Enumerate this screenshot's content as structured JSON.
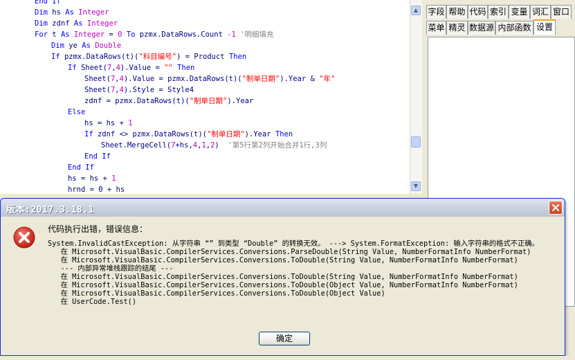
{
  "editor": {
    "lines": [
      {
        "indent": 50,
        "parts": [
          {
            "c": "kw",
            "t": "End If"
          }
        ]
      },
      {
        "indent": 50,
        "parts": [
          {
            "c": "kw",
            "t": "Dim "
          },
          {
            "c": "tx",
            "t": "hs "
          },
          {
            "c": "kw",
            "t": "As "
          },
          {
            "c": "ty",
            "t": "Integer"
          }
        ]
      },
      {
        "indent": 50,
        "parts": [
          {
            "c": "kw",
            "t": "Dim "
          },
          {
            "c": "tx",
            "t": "zdnf "
          },
          {
            "c": "kw",
            "t": "As "
          },
          {
            "c": "ty",
            "t": "Integer"
          }
        ]
      },
      {
        "indent": 50,
        "parts": [
          {
            "c": "kw",
            "t": "For "
          },
          {
            "c": "tx",
            "t": "t "
          },
          {
            "c": "kw",
            "t": "As "
          },
          {
            "c": "ty",
            "t": "Integer "
          },
          {
            "c": "tx",
            "t": "= "
          },
          {
            "c": "num",
            "t": "0 "
          },
          {
            "c": "kw",
            "t": "To "
          },
          {
            "c": "tx",
            "t": "pzmx.DataRows.Count "
          },
          {
            "c": "num",
            "t": "-1 "
          },
          {
            "c": "cm",
            "t": "'明细填充"
          }
        ]
      },
      {
        "indent": 74,
        "parts": [
          {
            "c": "kw",
            "t": "Dim "
          },
          {
            "c": "tx",
            "t": "ye "
          },
          {
            "c": "kw",
            "t": "As "
          },
          {
            "c": "ty",
            "t": "Double"
          }
        ]
      },
      {
        "indent": 74,
        "parts": [
          {
            "c": "kw",
            "t": "If "
          },
          {
            "c": "tx",
            "t": "pzmx.DataRows(t)("
          },
          {
            "c": "str",
            "t": "\"科目编号\""
          },
          {
            "c": "tx",
            "t": ") = Product "
          },
          {
            "c": "kw",
            "t": "Then"
          }
        ]
      },
      {
        "indent": 98,
        "parts": [
          {
            "c": "kw",
            "t": "If "
          },
          {
            "c": "tx",
            "t": "Sheet("
          },
          {
            "c": "num",
            "t": "7"
          },
          {
            "c": "tx",
            "t": ","
          },
          {
            "c": "num",
            "t": "4"
          },
          {
            "c": "tx",
            "t": ").Value = "
          },
          {
            "c": "str",
            "t": "\"\" "
          },
          {
            "c": "kw",
            "t": "Then"
          }
        ]
      },
      {
        "indent": 122,
        "parts": [
          {
            "c": "tx",
            "t": "Sheet("
          },
          {
            "c": "num",
            "t": "7"
          },
          {
            "c": "tx",
            "t": ","
          },
          {
            "c": "num",
            "t": "4"
          },
          {
            "c": "tx",
            "t": ").Value = pzmx.DataRows(t)("
          },
          {
            "c": "str",
            "t": "\"制单日期\""
          },
          {
            "c": "tx",
            "t": ").Year & "
          },
          {
            "c": "str",
            "t": "\"年\""
          }
        ]
      },
      {
        "indent": 122,
        "parts": [
          {
            "c": "tx",
            "t": "Sheet("
          },
          {
            "c": "num",
            "t": "7"
          },
          {
            "c": "tx",
            "t": ","
          },
          {
            "c": "num",
            "t": "4"
          },
          {
            "c": "tx",
            "t": ").Style = Style4"
          }
        ]
      },
      {
        "indent": 122,
        "parts": [
          {
            "c": "tx",
            "t": "zdnf = pzmx.DataRows(t)("
          },
          {
            "c": "str",
            "t": "\"制单日期\""
          },
          {
            "c": "tx",
            "t": ").Year"
          }
        ]
      },
      {
        "indent": 98,
        "parts": [
          {
            "c": "kw",
            "t": "Else"
          }
        ]
      },
      {
        "indent": 122,
        "parts": [
          {
            "c": "tx",
            "t": "hs = hs + "
          },
          {
            "c": "num",
            "t": "1"
          }
        ]
      },
      {
        "indent": 122,
        "parts": [
          {
            "c": "kw",
            "t": "If "
          },
          {
            "c": "tx",
            "t": "zdnf <> pzmx.DataRows(t)("
          },
          {
            "c": "str",
            "t": "\"制单日期\""
          },
          {
            "c": "tx",
            "t": ").Year "
          },
          {
            "c": "kw",
            "t": "Then"
          }
        ]
      },
      {
        "indent": 146,
        "parts": [
          {
            "c": "tx",
            "t": "Sheet.MergeCell("
          },
          {
            "c": "num",
            "t": "7"
          },
          {
            "c": "tx",
            "t": "+hs,"
          },
          {
            "c": "num",
            "t": "4"
          },
          {
            "c": "tx",
            "t": ","
          },
          {
            "c": "num",
            "t": "1"
          },
          {
            "c": "tx",
            "t": ","
          },
          {
            "c": "num",
            "t": "2"
          },
          {
            "c": "tx",
            "t": ")  "
          },
          {
            "c": "cm",
            "t": "'第5行第2列开始合并1行,3列"
          }
        ]
      },
      {
        "indent": 122,
        "parts": [
          {
            "c": "kw",
            "t": "End If"
          }
        ]
      },
      {
        "indent": 98,
        "parts": [
          {
            "c": "kw",
            "t": "End If"
          }
        ]
      },
      {
        "indent": 98,
        "parts": [
          {
            "c": "tx",
            "t": "hs = hs + "
          },
          {
            "c": "num",
            "t": "1"
          }
        ]
      },
      {
        "indent": 98,
        "parts": [
          {
            "c": "tx",
            "t": "hrnd = 0 + hs"
          }
        ]
      }
    ]
  },
  "right_panel": {
    "tabs_row1": [
      "字段",
      "帮助",
      "代码",
      "索引",
      "变量",
      "词汇",
      "窗口"
    ],
    "tabs_row2": [
      "菜单",
      "精灵",
      "数据源",
      "内部函数",
      "设置"
    ],
    "active_tab": "设置"
  },
  "dialog": {
    "title": "版本:2017.3.18.1",
    "message": "代码执行出错，错误信息：",
    "details": [
      "System.InvalidCastException: 从字符串 “” 到类型 “Double” 的转换无效。 ---> System.FormatException: 输入字符串的格式不正确。",
      "   在 Microsoft.VisualBasic.CompilerServices.Conversions.ParseDouble(String Value, NumberFormatInfo NumberFormat)",
      "   在 Microsoft.VisualBasic.CompilerServices.Conversions.ToDouble(String Value, NumberFormatInfo NumberFormat)",
      "   --- 内部异常堆栈跟踪的结尾 ---",
      "   在 Microsoft.VisualBasic.CompilerServices.Conversions.ToDouble(String Value, NumberFormatInfo NumberFormat)",
      "   在 Microsoft.VisualBasic.CompilerServices.Conversions.ToDouble(Object Value, NumberFormatInfo NumberFormat)",
      "   在 Microsoft.VisualBasic.CompilerServices.Conversions.ToDouble(Object Value)",
      "   在 UserCode.Test()"
    ],
    "ok_label": "确定"
  },
  "colors": {
    "keyword": "#0000ff",
    "type": "#c000c0",
    "string": "#ff0000",
    "comment": "#808080",
    "text": "#000080",
    "error_icon": "#d92a1c"
  },
  "icons": {
    "error": "error-icon",
    "close": "close-icon",
    "scroll_up": "arrow-up-icon",
    "scroll_down": "arrow-down-icon"
  }
}
